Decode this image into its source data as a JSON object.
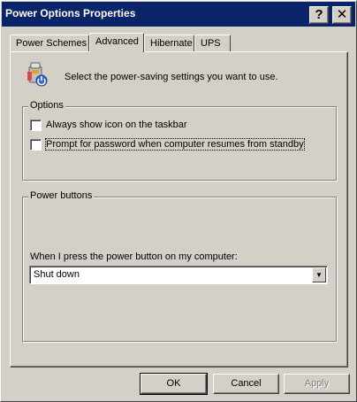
{
  "window": {
    "title": "Power Options Properties",
    "help_button": "?",
    "close_button": "✕"
  },
  "tabs": [
    {
      "label": "Power Schemes",
      "active": false
    },
    {
      "label": "Advanced",
      "active": true
    },
    {
      "label": "Hibernate",
      "active": false
    },
    {
      "label": "UPS",
      "active": false
    }
  ],
  "advanced": {
    "intro": "Select the power-saving settings you want to use.",
    "options_group": {
      "title": "Options",
      "checkboxes": [
        {
          "label": "Always show icon on the taskbar",
          "checked": false
        },
        {
          "label": "Prompt for password when computer resumes from standby",
          "checked": false
        }
      ]
    },
    "power_buttons_group": {
      "title": "Power buttons",
      "prompt": "When I press the power button on my computer:",
      "selected": "Shut down"
    }
  },
  "buttons": {
    "ok": "OK",
    "cancel": "Cancel",
    "apply": "Apply"
  },
  "colors": {
    "titlebar": "#0a246a",
    "face": "#d4d0c8"
  }
}
